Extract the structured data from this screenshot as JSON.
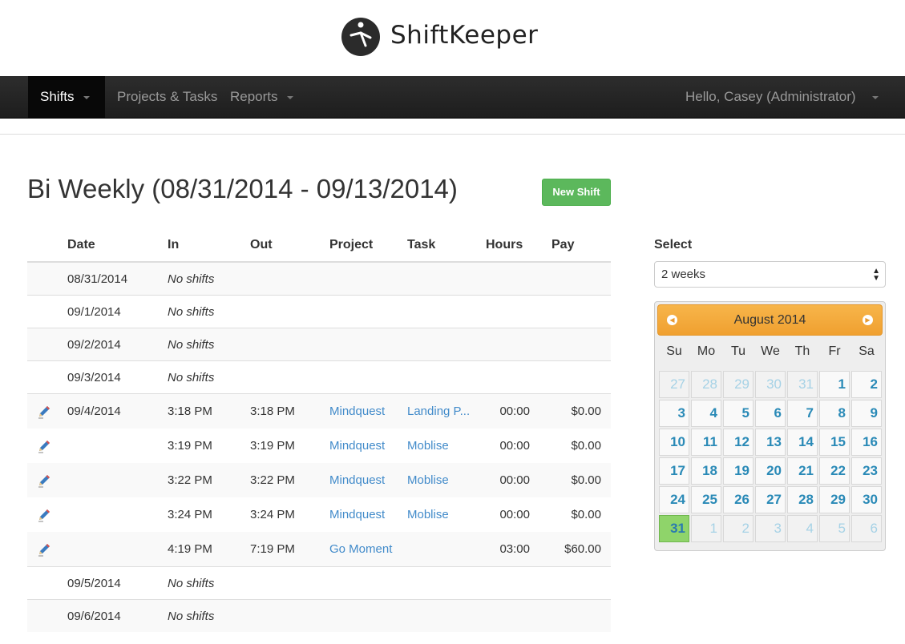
{
  "brand": {
    "name": "ShiftKeeper"
  },
  "nav": {
    "items": [
      {
        "label": "Shifts"
      },
      {
        "label": "Projects & Tasks"
      },
      {
        "label": "Reports"
      }
    ],
    "user": "Hello, Casey (Administrator)"
  },
  "page": {
    "title": "Bi Weekly (08/31/2014 - 09/13/2014)",
    "new_shift": "New Shift"
  },
  "table": {
    "headers": [
      "Date",
      "In",
      "Out",
      "Project",
      "Task",
      "Hours",
      "Pay"
    ],
    "rows": [
      {
        "date": "08/31/2014",
        "note": "No shifts"
      },
      {
        "date": "09/1/2014",
        "note": "No shifts"
      },
      {
        "date": "09/2/2014",
        "note": "No shifts"
      },
      {
        "date": "09/3/2014",
        "note": "No shifts"
      },
      {
        "date": "09/4/2014",
        "in": "3:18 PM",
        "out": "3:18 PM",
        "project": "Mindquest",
        "task": "Landing P...",
        "hours": "00:00",
        "pay": "$0.00"
      },
      {
        "date": "",
        "in": "3:19 PM",
        "out": "3:19 PM",
        "project": "Mindquest",
        "task": "Moblise",
        "hours": "00:00",
        "pay": "$0.00"
      },
      {
        "date": "",
        "in": "3:22 PM",
        "out": "3:22 PM",
        "project": "Mindquest",
        "task": "Moblise",
        "hours": "00:00",
        "pay": "$0.00"
      },
      {
        "date": "",
        "in": "3:24 PM",
        "out": "3:24 PM",
        "project": "Mindquest",
        "task": "Moblise",
        "hours": "00:00",
        "pay": "$0.00"
      },
      {
        "date": "",
        "in": "4:19 PM",
        "out": "7:19 PM",
        "project": "Go Moment",
        "task": "",
        "hours": "03:00",
        "pay": "$60.00"
      },
      {
        "date": "09/5/2014",
        "note": "No shifts"
      },
      {
        "date": "09/6/2014",
        "note": "No shifts"
      }
    ]
  },
  "sidebar": {
    "select_label": "Select",
    "select_value": "2 weeks",
    "calendar": {
      "month": "August 2014",
      "dow": [
        "Su",
        "Mo",
        "Tu",
        "We",
        "Th",
        "Fr",
        "Sa"
      ],
      "weeks": [
        [
          "27",
          "28",
          "29",
          "30",
          "31",
          "1",
          "2"
        ],
        [
          "3",
          "4",
          "5",
          "6",
          "7",
          "8",
          "9"
        ],
        [
          "10",
          "11",
          "12",
          "13",
          "14",
          "15",
          "16"
        ],
        [
          "17",
          "18",
          "19",
          "20",
          "21",
          "22",
          "23"
        ],
        [
          "24",
          "25",
          "26",
          "27",
          "28",
          "29",
          "30"
        ],
        [
          "31",
          "1",
          "2",
          "3",
          "4",
          "5",
          "6"
        ]
      ]
    }
  },
  "colors": {
    "navbar": "#222222",
    "accent_green": "#5cb85c",
    "link": "#428bca",
    "calendar_header": "#f0a030",
    "today": "#8fd46a"
  }
}
